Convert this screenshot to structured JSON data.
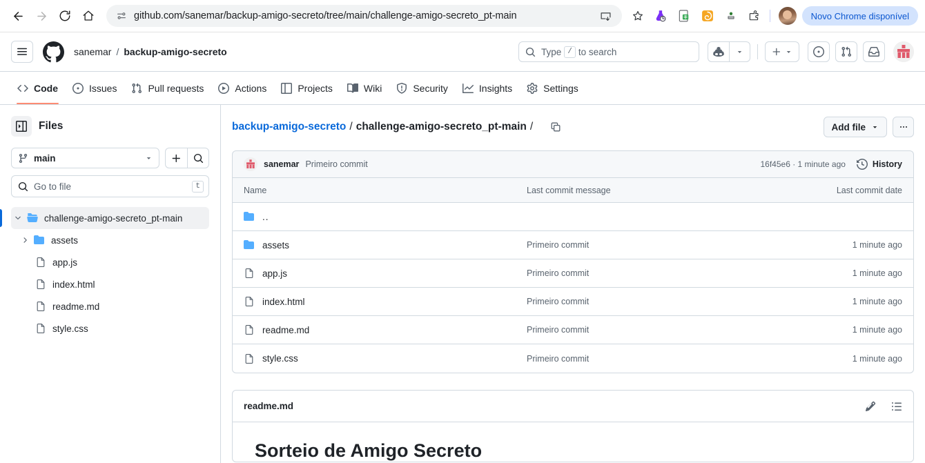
{
  "browser": {
    "url": "github.com/sanemar/backup-amigo-secreto/tree/main/challenge-amigo-secreto_pt-main",
    "update_pill": "Novo Chrome disponível",
    "back_icon": "back-arrow-icon",
    "forward_icon": "forward-arrow-icon",
    "reload_icon": "reload-icon",
    "home_icon": "home-icon",
    "site_info_icon": "site-settings-icon",
    "install_icon": "install-app-icon",
    "bookmark_icon": "star-icon",
    "extensions_icon": "extensions-puzzle-icon"
  },
  "gh_header": {
    "menu_icon": "hamburger-menu-icon",
    "logo_icon": "github-logo-icon",
    "owner": "sanemar",
    "separator": "/",
    "repo": "backup-amigo-secreto",
    "search_placeholder": "Type",
    "search_kbd": "/",
    "search_suffix": "to search",
    "copilot_icon": "copilot-icon",
    "create_new_icon": "plus-icon",
    "issues_icon": "issues-dot-icon",
    "pull_requests_icon": "pull-request-icon",
    "inbox_icon": "inbox-icon",
    "avatar_icon": "user-avatar"
  },
  "nav_tabs": [
    {
      "label": "Code",
      "icon": "code-icon",
      "active": true
    },
    {
      "label": "Issues",
      "icon": "issue-opened-icon",
      "active": false
    },
    {
      "label": "Pull requests",
      "icon": "git-pull-request-icon",
      "active": false
    },
    {
      "label": "Actions",
      "icon": "play-icon",
      "active": false
    },
    {
      "label": "Projects",
      "icon": "table-icon",
      "active": false
    },
    {
      "label": "Wiki",
      "icon": "book-icon",
      "active": false
    },
    {
      "label": "Security",
      "icon": "shield-icon",
      "active": false
    },
    {
      "label": "Insights",
      "icon": "graph-icon",
      "active": false
    },
    {
      "label": "Settings",
      "icon": "gear-icon",
      "active": false
    }
  ],
  "sidebar": {
    "panel_toggle_icon": "sidebar-collapse-icon",
    "title": "Files",
    "branch": "main",
    "branch_icon": "git-branch-icon",
    "branch_caret_icon": "chevron-down-icon",
    "add_icon": "plus-icon",
    "search_icon": "search-icon",
    "gotofile_placeholder": "Go to file",
    "gotofile_kbd": "t",
    "tree": [
      {
        "label": "challenge-amigo-secreto_pt-main",
        "type": "folder-open",
        "selected": true,
        "expanded": true,
        "depth": 0
      },
      {
        "label": "assets",
        "type": "folder",
        "selected": false,
        "expanded": false,
        "depth": 1
      },
      {
        "label": "app.js",
        "type": "file",
        "selected": false,
        "depth": 1
      },
      {
        "label": "index.html",
        "type": "file",
        "selected": false,
        "depth": 1
      },
      {
        "label": "readme.md",
        "type": "file",
        "selected": false,
        "depth": 1
      },
      {
        "label": "style.css",
        "type": "file",
        "selected": false,
        "depth": 1
      }
    ]
  },
  "main": {
    "breadcrumb_repo": "backup-amigo-secreto",
    "breadcrumb_sep1": "/",
    "breadcrumb_dir": "challenge-amigo-secreto_pt-main",
    "breadcrumb_sep2": "/",
    "copy_path_icon": "copy-icon",
    "add_file_label": "Add file",
    "add_file_caret_icon": "chevron-down-icon",
    "kebab_icon": "kebab-horizontal-icon",
    "commit": {
      "author": "sanemar",
      "message": "Primeiro commit",
      "meta": "16f45e6 · 1 minute ago",
      "history_label": "History",
      "history_icon": "history-clock-icon"
    },
    "table": {
      "headers": {
        "name": "Name",
        "message": "Last commit message",
        "date": "Last commit date"
      },
      "rows": [
        {
          "name": "..",
          "type": "folder",
          "message": "",
          "date": ""
        },
        {
          "name": "assets",
          "type": "folder",
          "message": "Primeiro commit",
          "date": "1 minute ago"
        },
        {
          "name": "app.js",
          "type": "file",
          "message": "Primeiro commit",
          "date": "1 minute ago"
        },
        {
          "name": "index.html",
          "type": "file",
          "message": "Primeiro commit",
          "date": "1 minute ago"
        },
        {
          "name": "readme.md",
          "type": "file",
          "message": "Primeiro commit",
          "date": "1 minute ago"
        },
        {
          "name": "style.css",
          "type": "file",
          "message": "Primeiro commit",
          "date": "1 minute ago"
        }
      ]
    },
    "readme": {
      "title": "readme.md",
      "edit_icon": "pencil-icon",
      "outline_icon": "list-unordered-icon",
      "heading": "Sorteio de Amigo Secreto"
    }
  },
  "colors": {
    "accent_blue": "#0969da",
    "tab_underline": "#fd8c73",
    "border": "#d1d9e0",
    "folder_blue": "#54aeff",
    "chrome_pill_bg": "#d3e3fd",
    "chrome_pill_text": "#0b57d0"
  }
}
